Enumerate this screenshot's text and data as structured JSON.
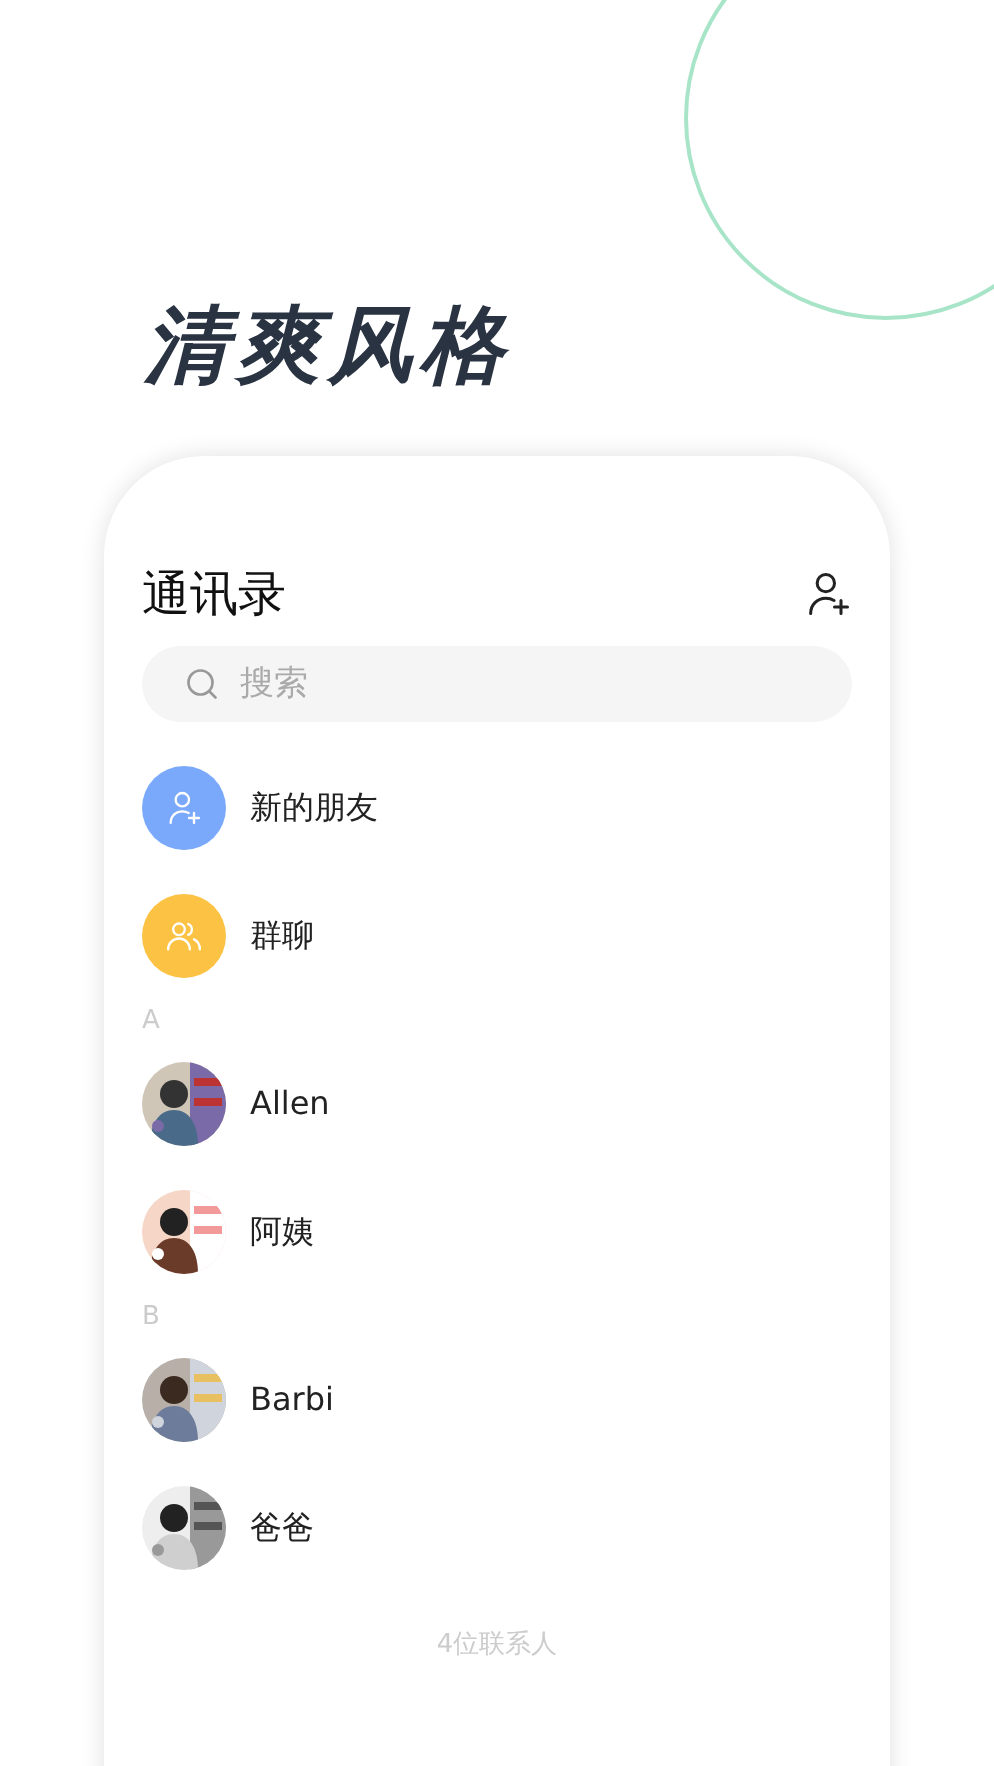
{
  "headline": "清爽风格",
  "screen": {
    "title": "通讯录",
    "search": {
      "placeholder": "搜索"
    },
    "features": [
      {
        "label": "新的朋友",
        "kind": "add-friend",
        "color": "#7aa9fb"
      },
      {
        "label": "群聊",
        "kind": "group",
        "color": "#fbc244"
      }
    ],
    "sections": [
      {
        "letter": "A",
        "contacts": [
          {
            "name": "Allen"
          },
          {
            "name": "阿姨"
          }
        ]
      },
      {
        "letter": "B",
        "contacts": [
          {
            "name": "Barbi"
          },
          {
            "name": "爸爸"
          }
        ]
      }
    ],
    "footer": "4位联系人"
  }
}
